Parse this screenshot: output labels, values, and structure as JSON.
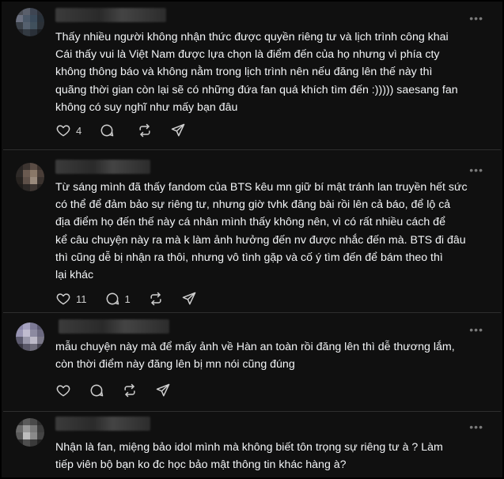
{
  "colors": {
    "background": "#101010",
    "text": "#f3f5f7",
    "muted": "#7a7a7a",
    "divider": "#2e2e2e"
  },
  "icons": [
    "heart-icon",
    "comment-icon",
    "repost-icon",
    "share-icon",
    "more-icon"
  ],
  "more_label": "•••",
  "posts": [
    {
      "text": "Thấy nhiều người không nhận thức được quyền riêng tư và lịch trình công khai\nCái thấy vui là Việt Nam được lựa chọn là điểm đến của họ nhưng vì phía cty\nkhông thông báo và không nằm trong lịch trình nên nếu đăng lên thế này thì\nquãng thời gian còn lại sẽ có những đứa fan quá khích tìm đến :))))) saesang fan\nkhông có suy nghĩ như mấy bạn đâu",
      "likes": "4",
      "comments": ""
    },
    {
      "text": "Từ sáng mình đã thấy fandom của BTS kêu mn giữ bí mật tránh lan truyền hết sức\ncó thể để đảm bảo sự riêng tư, nhưng giờ tvhk đăng bài rồi lên cả báo, để lộ cả\nđịa điểm họ đến thế này cá nhân mình thấy không nên, vì có rất nhiều cách để\nkể câu chuyện này ra mà k làm ảnh hưởng đến nv được nhắc đến mà. BTS đi đâu\nthì cũng dễ bị nhận ra thôi, nhưng vô tình gặp và cố ý tìm đến để bám theo thì\nlại khác",
      "likes": "11",
      "comments": "1"
    },
    {
      "text": "mẫu chuyện này mà để mấy ảnh về Hàn an toàn rồi đăng lên thì dễ thương lắm,\ncòn thời điểm này đăng lên bị mn nói cũng đúng",
      "likes": "",
      "comments": ""
    },
    {
      "text": "Nhận là fan, miệng bảo idol mình mà không biết tôn trọng sự riêng tư à ? Làm\ntiếp viên bộ bạn ko đc học bảo mật thông tin khác hàng à?",
      "likes": "",
      "comments": ""
    }
  ]
}
